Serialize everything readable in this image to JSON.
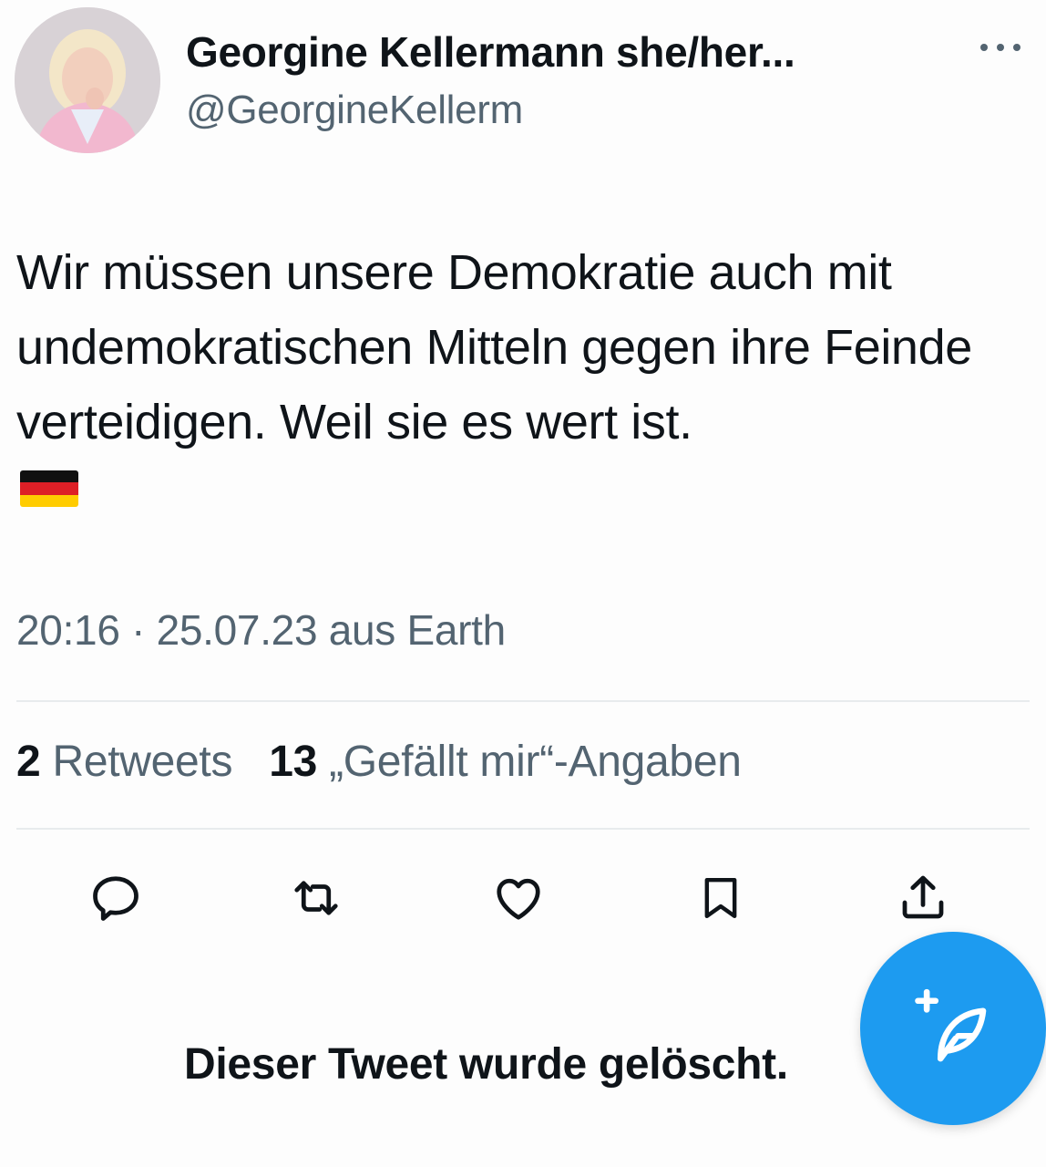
{
  "colors": {
    "accent": "#1d9bf0",
    "text_primary": "#0f1419",
    "text_secondary": "#536471",
    "divider": "#e8ebed"
  },
  "tweet": {
    "author": {
      "display_name": "Georgine Kellermann she/her...",
      "handle": "@GeorgineKellerm",
      "avatar_icon": "profile-photo"
    },
    "more_icon": "more-horizontal-icon",
    "text": "Wir müssen unsere Demokratie auch mit undemokratischen Mitteln gegen ihre Feinde verteidigen. Weil sie es wert ist.",
    "emoji": "flag-germany",
    "meta": "20:16 · 25.07.23 aus Earth",
    "stats": {
      "retweets_count": "2",
      "retweets_label": "Retweets",
      "likes_count": "13",
      "likes_label": "„Gefällt mir“-Angaben"
    },
    "actions": [
      "reply-icon",
      "retweet-icon",
      "like-icon",
      "bookmark-icon",
      "share-icon"
    ]
  },
  "deleted_notice": "Dieser Tweet wurde gelöscht.",
  "compose_button_icon": "compose-tweet-icon"
}
